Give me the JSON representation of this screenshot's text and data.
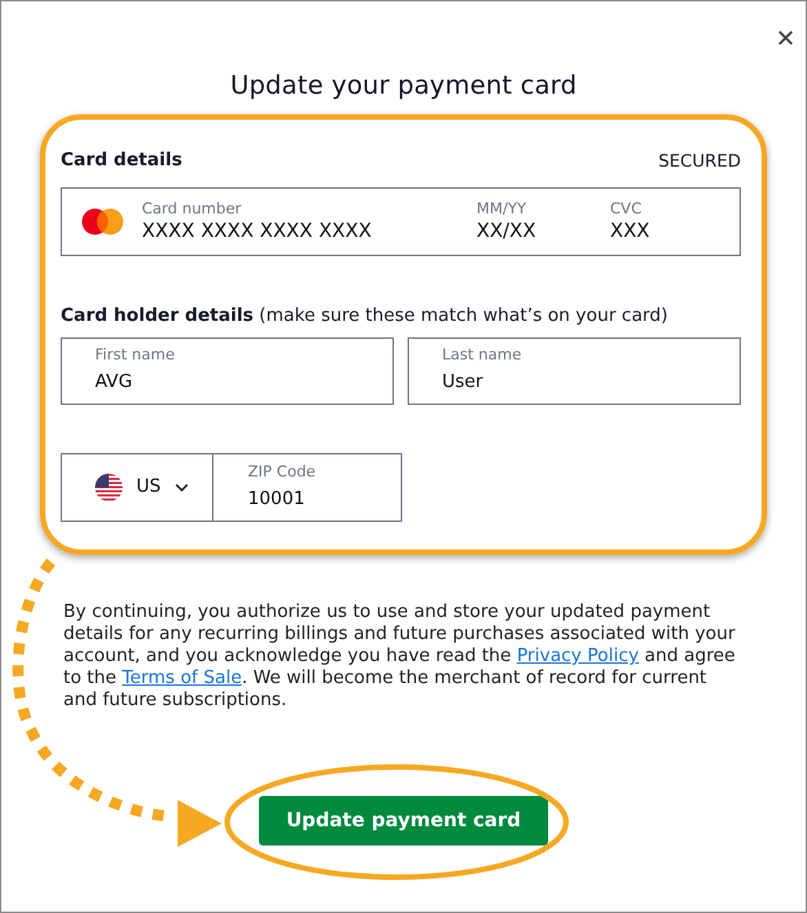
{
  "title": "Update your payment card",
  "card_details": {
    "heading": "Card details",
    "badge": "SECURED",
    "fields": [
      {
        "label": "Card number",
        "value": "XXXX XXXX XXXX XXXX"
      },
      {
        "label": "MM/YY",
        "value": "XX/XX"
      },
      {
        "label": "CVC",
        "value": "XXX"
      }
    ]
  },
  "card_holder": {
    "heading": "Card holder details",
    "note": "(make sure these match what’s on your card)",
    "fields": [
      {
        "label": "First name",
        "value": "AVG"
      },
      {
        "label": "Last name",
        "value": "User"
      }
    ]
  },
  "country": {
    "value": "US"
  },
  "zip": {
    "label": "ZIP Code",
    "value": "10001"
  },
  "consent": [
    {
      "kind": "text",
      "text": "By continuing, you authorize us to use and store your updated payment details for any recurring billings and future purchases associated with your account, and you acknowledge you have read the "
    },
    {
      "kind": "link",
      "text": "Privacy Policy"
    },
    {
      "kind": "text",
      "text": " and agree to the "
    },
    {
      "kind": "link",
      "text": "Terms of Sale"
    },
    {
      "kind": "text",
      "text": ". We will become the merchant of record for current and future subscriptions."
    }
  ],
  "submit": "Update payment card"
}
